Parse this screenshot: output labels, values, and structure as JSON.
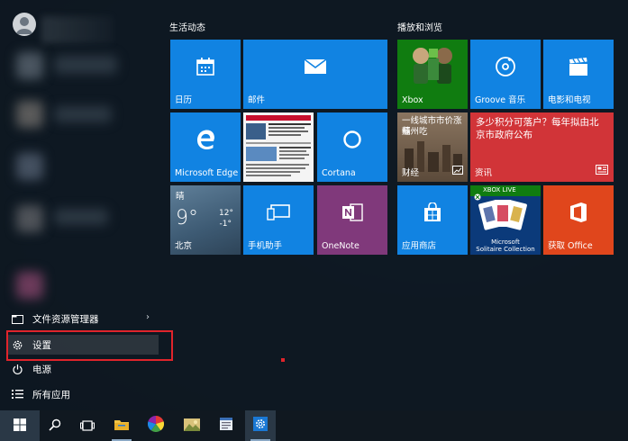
{
  "left_menu": {
    "file_explorer": "文件资源管理器",
    "settings": "设置",
    "power": "电源",
    "all_apps": "所有应用"
  },
  "groups": {
    "life": "生活动态",
    "play": "播放和浏览"
  },
  "tiles": {
    "calendar": "日历",
    "mail": "邮件",
    "edge": "Microsoft Edge",
    "cortana": "Cortana",
    "weather_condition": "晴",
    "weather_temp": "9°",
    "weather_high": "12°",
    "weather_low": "-1°",
    "weather_city": "北京",
    "phone_companion": "手机助手",
    "onenote": "OneNote",
    "xbox": "Xbox",
    "groove": "Groove 音乐",
    "movies": "电影和电视",
    "finance_headline": "一线城市市价涨幅",
    "finance_sub": "蘇州吃",
    "finance": "财经",
    "news_headline": "多少积分可落户？每年拟由北京市政府公布",
    "news": "资讯",
    "store": "应用商店",
    "solitaire_badge": "XBOX LIVE",
    "solitaire_title_line1": "Microsoft",
    "solitaire_title_line2": "Solitaire Collection",
    "get_office": "获取 Office"
  },
  "colors": {
    "tile_blue": "#1183e2",
    "news_red": "#d13438",
    "office_orange": "#e0461c",
    "highlight_red": "#e0242b"
  }
}
